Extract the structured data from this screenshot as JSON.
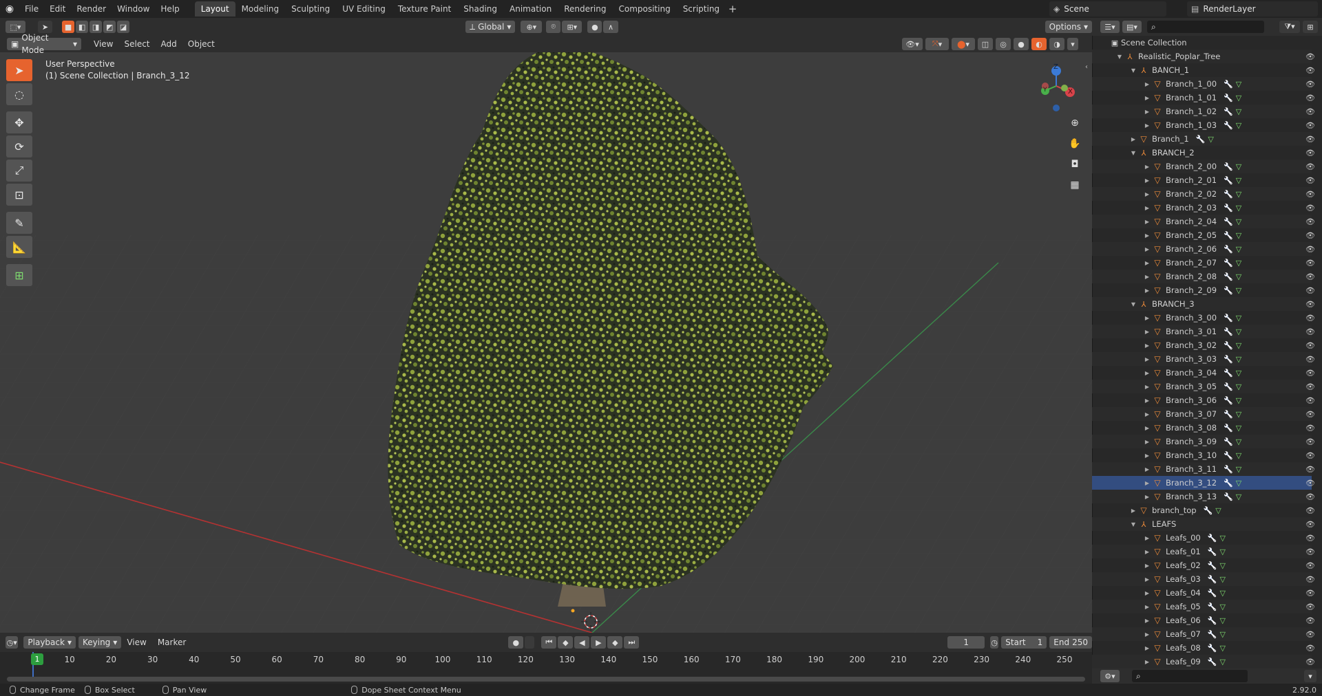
{
  "menubar": {
    "items": [
      "File",
      "Edit",
      "Render",
      "Window",
      "Help"
    ],
    "workspaces": [
      "Layout",
      "Modeling",
      "Sculpting",
      "UV Editing",
      "Texture Paint",
      "Shading",
      "Animation",
      "Rendering",
      "Compositing",
      "Scripting"
    ],
    "active_workspace": "Layout",
    "scene_label": "Scene",
    "render_layer_label": "RenderLayer"
  },
  "header3d": {
    "mode": "Object Mode",
    "menus": [
      "View",
      "Select",
      "Add",
      "Object"
    ],
    "transform_orientation": "Global",
    "options_label": "Options"
  },
  "viewport": {
    "perspective_label": "User Perspective",
    "collection_label": "(1) Scene Collection | Branch_3_12",
    "axes": {
      "x": "X",
      "y": "Y",
      "z": "Z"
    },
    "colors": {
      "background": "#3d3d3d",
      "x_axis": "#b53232",
      "y_axis": "#3a8a4a",
      "active_tool": "#e6632e"
    }
  },
  "timeline": {
    "menus": [
      "Playback",
      "Keying",
      "View",
      "Marker"
    ],
    "current_frame": "1",
    "start_label": "Start",
    "start_value": "1",
    "end_label": "End",
    "end_value": "250",
    "frame_ticks": [
      "10",
      "20",
      "30",
      "40",
      "50",
      "60",
      "70",
      "80",
      "90",
      "100",
      "110",
      "120",
      "130",
      "140",
      "150",
      "160",
      "170",
      "180",
      "190",
      "200",
      "210",
      "220",
      "230",
      "240",
      "250"
    ],
    "playhead_label": "1"
  },
  "statusbar": {
    "items": [
      "Change Frame",
      "Box Select",
      "Pan View",
      "Dope Sheet Context Menu"
    ],
    "version": "2.92.0"
  },
  "outliner": {
    "root": "Scene Collection",
    "rows": [
      {
        "label": "Realistic_Poplar_Tree",
        "level": 1,
        "kind": "empty",
        "expanded": true,
        "mods": false
      },
      {
        "label": "BANCH_1",
        "level": 2,
        "kind": "empty",
        "expanded": true,
        "mods": false
      },
      {
        "label": "Branch_1_00",
        "level": 3,
        "kind": "mesh",
        "mods": true
      },
      {
        "label": "Branch_1_01",
        "level": 3,
        "kind": "mesh",
        "mods": true
      },
      {
        "label": "Branch_1_02",
        "level": 3,
        "kind": "mesh",
        "mods": true
      },
      {
        "label": "Branch_1_03",
        "level": 3,
        "kind": "mesh",
        "mods": true
      },
      {
        "label": "Branch_1",
        "level": 2,
        "kind": "mesh",
        "collapsed": true,
        "mods": true
      },
      {
        "label": "BRANCH_2",
        "level": 2,
        "kind": "empty",
        "expanded": true,
        "mods": false
      },
      {
        "label": "Branch_2_00",
        "level": 3,
        "kind": "mesh",
        "mods": true
      },
      {
        "label": "Branch_2_01",
        "level": 3,
        "kind": "mesh",
        "mods": true
      },
      {
        "label": "Branch_2_02",
        "level": 3,
        "kind": "mesh",
        "mods": true
      },
      {
        "label": "Branch_2_03",
        "level": 3,
        "kind": "mesh",
        "mods": true
      },
      {
        "label": "Branch_2_04",
        "level": 3,
        "kind": "mesh",
        "mods": true
      },
      {
        "label": "Branch_2_05",
        "level": 3,
        "kind": "mesh",
        "mods": true
      },
      {
        "label": "Branch_2_06",
        "level": 3,
        "kind": "mesh",
        "mods": true
      },
      {
        "label": "Branch_2_07",
        "level": 3,
        "kind": "mesh",
        "mods": true
      },
      {
        "label": "Branch_2_08",
        "level": 3,
        "kind": "mesh",
        "mods": true
      },
      {
        "label": "Branch_2_09",
        "level": 3,
        "kind": "mesh",
        "mods": true
      },
      {
        "label": "BRANCH_3",
        "level": 2,
        "kind": "empty",
        "expanded": true,
        "mods": false
      },
      {
        "label": "Branch_3_00",
        "level": 3,
        "kind": "mesh",
        "mods": true
      },
      {
        "label": "Branch_3_01",
        "level": 3,
        "kind": "mesh",
        "mods": true
      },
      {
        "label": "Branch_3_02",
        "level": 3,
        "kind": "mesh",
        "mods": true
      },
      {
        "label": "Branch_3_03",
        "level": 3,
        "kind": "mesh",
        "mods": true
      },
      {
        "label": "Branch_3_04",
        "level": 3,
        "kind": "mesh",
        "mods": true
      },
      {
        "label": "Branch_3_05",
        "level": 3,
        "kind": "mesh",
        "mods": true
      },
      {
        "label": "Branch_3_06",
        "level": 3,
        "kind": "mesh",
        "mods": true
      },
      {
        "label": "Branch_3_07",
        "level": 3,
        "kind": "mesh",
        "mods": true
      },
      {
        "label": "Branch_3_08",
        "level": 3,
        "kind": "mesh",
        "mods": true
      },
      {
        "label": "Branch_3_09",
        "level": 3,
        "kind": "mesh",
        "mods": true
      },
      {
        "label": "Branch_3_10",
        "level": 3,
        "kind": "mesh",
        "mods": true
      },
      {
        "label": "Branch_3_11",
        "level": 3,
        "kind": "mesh",
        "mods": true
      },
      {
        "label": "Branch_3_12",
        "level": 3,
        "kind": "mesh",
        "mods": true,
        "active": true
      },
      {
        "label": "Branch_3_13",
        "level": 3,
        "kind": "mesh",
        "mods": true
      },
      {
        "label": "branch_top",
        "level": 2,
        "kind": "mesh",
        "collapsed": true,
        "mods": true
      },
      {
        "label": "LEAFS",
        "level": 2,
        "kind": "empty",
        "expanded": true,
        "mods": false
      },
      {
        "label": "Leafs_00",
        "level": 3,
        "kind": "mesh",
        "mods": true
      },
      {
        "label": "Leafs_01",
        "level": 3,
        "kind": "mesh",
        "mods": true
      },
      {
        "label": "Leafs_02",
        "level": 3,
        "kind": "mesh",
        "mods": true
      },
      {
        "label": "Leafs_03",
        "level": 3,
        "kind": "mesh",
        "mods": true
      },
      {
        "label": "Leafs_04",
        "level": 3,
        "kind": "mesh",
        "mods": true
      },
      {
        "label": "Leafs_05",
        "level": 3,
        "kind": "mesh",
        "mods": true
      },
      {
        "label": "Leafs_06",
        "level": 3,
        "kind": "mesh",
        "mods": true
      },
      {
        "label": "Leafs_07",
        "level": 3,
        "kind": "mesh",
        "mods": true
      },
      {
        "label": "Leafs_08",
        "level": 3,
        "kind": "mesh",
        "mods": true
      },
      {
        "label": "Leafs_09",
        "level": 3,
        "kind": "mesh",
        "mods": true
      }
    ]
  }
}
